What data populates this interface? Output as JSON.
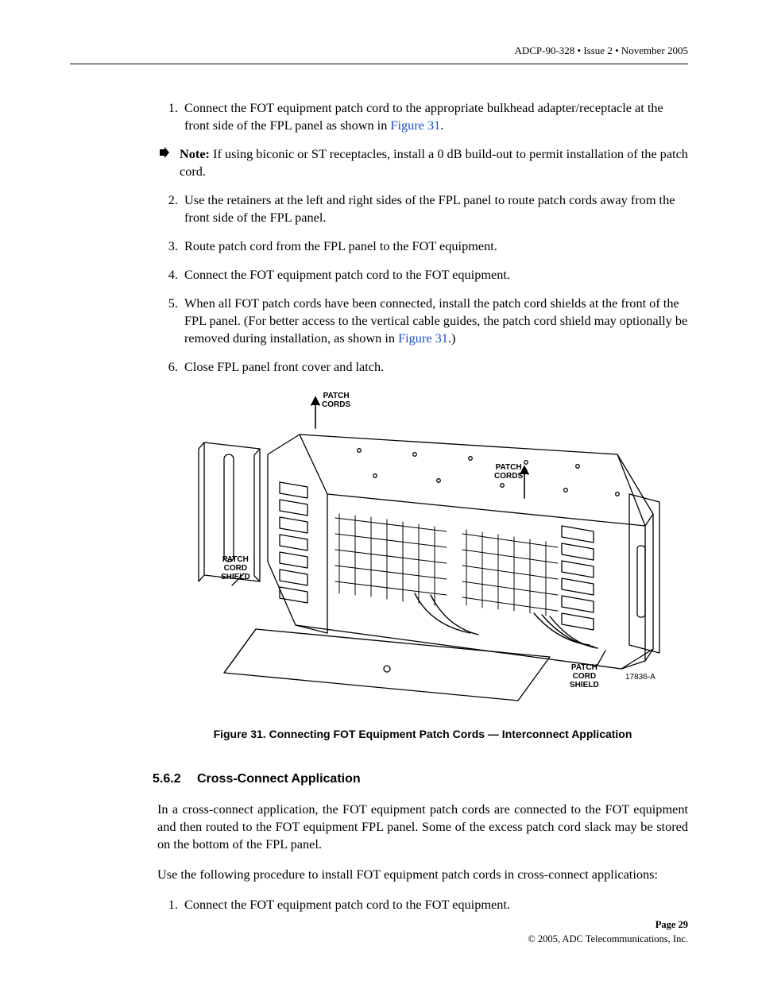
{
  "header": "ADCP-90-328 • Issue 2 • November 2005",
  "list": {
    "i1": {
      "n": "1.",
      "before": "Connect the FOT equipment patch cord to the appropriate bulkhead adapter/receptacle at the front side of the FPL panel as shown in ",
      "link": "Figure 31",
      "after": "."
    },
    "note": {
      "label": "Note:",
      "text": " If using biconic or ST receptacles, install a 0 dB build-out to permit installation of the patch cord."
    },
    "i2": {
      "n": "2.",
      "text": "Use the retainers at the left and right sides of the FPL panel to route patch cords away from the front side of the FPL panel."
    },
    "i3": {
      "n": "3.",
      "text": "Route patch cord from the FPL panel to the FOT equipment."
    },
    "i4": {
      "n": "4.",
      "text": "Connect the FOT equipment patch cord to the FOT equipment."
    },
    "i5": {
      "n": "5.",
      "before": "When all FOT patch cords have been connected, install the patch cord shields at the front of the FPL panel. (For better access to the vertical cable guides, the patch cord shield may optionally be removed during installation, as shown in ",
      "link": "Figure 31",
      "after": ".)"
    },
    "i6": {
      "n": "6.",
      "text": "Close FPL panel front cover and latch."
    }
  },
  "figure": {
    "label_tl1": "PATCH",
    "label_tl2": "CORDS",
    "label_tr1": "PATCH",
    "label_tr2": "CORDS",
    "label_ml1": "PATCH",
    "label_ml2": "CORD",
    "label_ml3": "SHIELD",
    "label_br1": "PATCH",
    "label_br2": "CORD",
    "label_br3": "SHIELD",
    "id": "17836-A",
    "caption": "Figure 31. Connecting FOT Equipment Patch Cords — Interconnect Application"
  },
  "section": {
    "num": "5.6.2",
    "title": "Cross-Connect Application",
    "p1": "In a cross-connect application, the FOT equipment patch cords are connected to the FOT equipment and then routed to the FOT equipment FPL panel. Some of the excess patch cord slack may be stored on the bottom of the FPL panel.",
    "p2": "Use the following procedure to install FOT equipment patch cords in cross-connect applications:",
    "step1n": "1.",
    "step1": "Connect the FOT equipment patch cord to the FOT equipment."
  },
  "footer": {
    "page": "Page 29",
    "copy": "© 2005, ADC Telecommunications, Inc."
  }
}
